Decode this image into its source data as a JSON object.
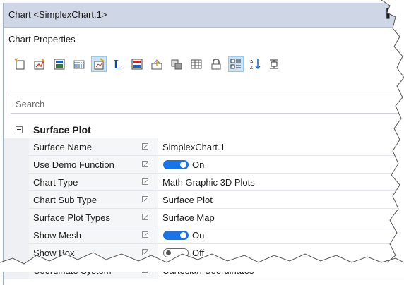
{
  "window": {
    "title": "Chart <SimplexChart.1>",
    "pin_glyph": "▕"
  },
  "subheader": {
    "label": "Chart Properties"
  },
  "toolbar": {
    "icons": [
      "new-chart-icon",
      "chart-wizard-icon",
      "chart-area-icon",
      "grid-lines-icon",
      "properties-icon",
      "axis-label-icon",
      "series-icon",
      "data-import-icon",
      "format-icon",
      "table-icon",
      "export-icon",
      "categorized-icon",
      "sort-icon",
      "collapse-icon"
    ],
    "axis_letter": "L",
    "sort_glyph": "A↓Z"
  },
  "search": {
    "placeholder": "Search"
  },
  "category": {
    "title": "Surface Plot"
  },
  "rows": [
    {
      "name": "Surface Name",
      "value": "SimplexChart.1"
    },
    {
      "name": "Use Demo Function",
      "value": "On"
    },
    {
      "name": "Chart Type",
      "value": "Math Graphic 3D Plots"
    },
    {
      "name": "Chart Sub Type",
      "value": "Surface Plot"
    },
    {
      "name": "Surface Plot Types",
      "value": "Surface Map"
    },
    {
      "name": "Show Mesh",
      "value": "On"
    },
    {
      "name": "Show Box",
      "value": "Off"
    },
    {
      "name": "Coordinate System",
      "value": "Cartesian Coordinates"
    }
  ],
  "colors": {
    "titlebar": "#cfd6e5",
    "accent": "#1a73e8",
    "active_tool": "#cce4f7"
  }
}
